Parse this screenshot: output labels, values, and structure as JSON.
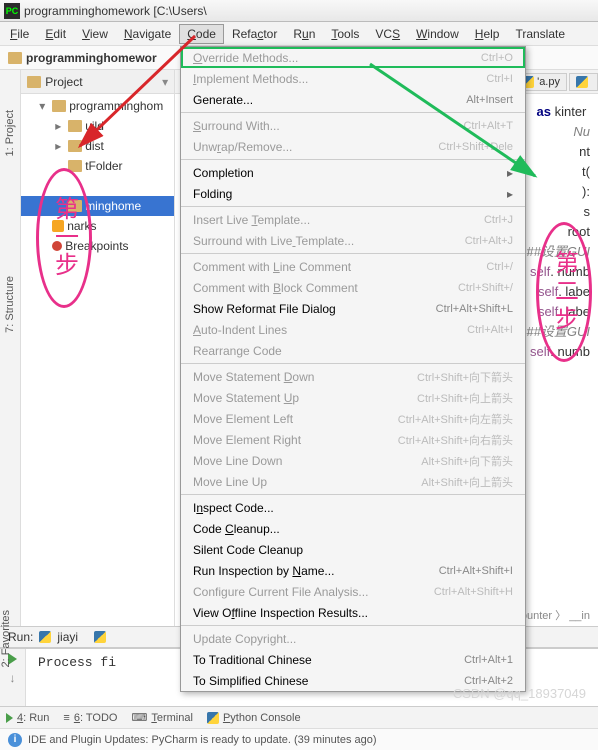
{
  "title": "programminghomework [C:\\Users\\",
  "menubar": [
    "File",
    "Edit",
    "View",
    "Navigate",
    "Code",
    "Refactor",
    "Run",
    "Tools",
    "VCS",
    "Window",
    "Help",
    "Translate"
  ],
  "menubar_underline": [
    0,
    0,
    0,
    0,
    0,
    4,
    1,
    0,
    2,
    0,
    0,
    -1
  ],
  "active_menu_index": 4,
  "breadcrumb": "programminghomewor",
  "project_header": "Project",
  "tree": [
    {
      "label": "programminghom",
      "icon": "folder",
      "ind": 1,
      "exp": "▾"
    },
    {
      "label": "uild",
      "icon": "folder",
      "ind": 2,
      "exp": "▸"
    },
    {
      "label": "dist",
      "icon": "folder",
      "ind": 2,
      "exp": "▸"
    },
    {
      "label": "tFolder",
      "icon": "folder",
      "ind": 2,
      "exp": ""
    },
    {
      "label": "",
      "icon": "",
      "ind": 2,
      "exp": ""
    },
    {
      "label": "minghome",
      "icon": "folder",
      "ind": 2,
      "exp": "",
      "sel": true
    },
    {
      "label": "narks",
      "icon": "book",
      "ind": 1,
      "exp": ""
    },
    {
      "label": "Breakpoints",
      "icon": "dot",
      "ind": 1,
      "exp": ""
    }
  ],
  "left_gutter": [
    "1: Project",
    "7: Structure",
    "2: Favorites"
  ],
  "tabs": [
    {
      "label": "'a.py"
    },
    {
      "label": ""
    }
  ],
  "code_lines": [
    "",
    "<span class='kw'>as</span> kinter ",
    "",
    "<span class='cm'>Nu</span>",
    "nt",
    "t(",
    "):",
    "",
    "",
    "",
    "s",
    "root",
    "",
    "<span class='cm'>##设置GUI</span>",
    "<span class='slf'>self</span>. numb",
    "<span class='slf'>self</span>. labe",
    "<span class='slf'>self</span>. labe",
    "",
    "<span class='cm'>##设置GUI</span>",
    "<span class='slf'>self</span>. numb"
  ],
  "breadcrumb_code": "ounter 〉 __in",
  "dropdown": [
    {
      "label": "Override Methods...",
      "sc": "Ctrl+O",
      "hl": true,
      "dis": true,
      "u": 0
    },
    {
      "label": "Implement Methods...",
      "sc": "Ctrl+I",
      "dis": true,
      "u": 0
    },
    {
      "label": "Generate...",
      "sc": "Alt+Insert",
      "u": -1
    },
    {
      "sep": true
    },
    {
      "label": "Surround With...",
      "sc": "Ctrl+Alt+T",
      "dis": true,
      "u": 0
    },
    {
      "label": "Unwrap/Remove...",
      "sc": "Ctrl+Shift+Dele",
      "dis": true,
      "u": 3
    },
    {
      "sep": true
    },
    {
      "label": "Completion",
      "sub": true,
      "u": -1
    },
    {
      "label": "Folding",
      "sub": true,
      "u": -1
    },
    {
      "sep": true
    },
    {
      "label": "Insert Live Template...",
      "sc": "Ctrl+J",
      "dis": true,
      "u": 12
    },
    {
      "label": "Surround with Live Template...",
      "sc": "Ctrl+Alt+J",
      "dis": true,
      "u": 18
    },
    {
      "sep": true
    },
    {
      "label": "Comment with Line Comment",
      "sc": "Ctrl+/",
      "dis": true,
      "u": 13
    },
    {
      "label": "Comment with Block Comment",
      "sc": "Ctrl+Shift+/",
      "dis": true,
      "u": 13
    },
    {
      "label": "Show Reformat File Dialog",
      "sc": "Ctrl+Alt+Shift+L",
      "u": -1
    },
    {
      "label": "Auto-Indent Lines",
      "sc": "Ctrl+Alt+I",
      "dis": true,
      "u": 0
    },
    {
      "label": "Rearrange Code",
      "dis": true,
      "u": -1
    },
    {
      "sep": true
    },
    {
      "label": "Move Statement Down",
      "sc": "Ctrl+Shift+向下箭头",
      "dis": true,
      "u": 15
    },
    {
      "label": "Move Statement Up",
      "sc": "Ctrl+Shift+向上箭头",
      "dis": true,
      "u": 15
    },
    {
      "label": "Move Element Left",
      "sc": "Ctrl+Alt+Shift+向左箭头",
      "dis": true,
      "u": -1
    },
    {
      "label": "Move Element Right",
      "sc": "Ctrl+Alt+Shift+向右箭头",
      "dis": true,
      "u": -1
    },
    {
      "label": "Move Line Down",
      "sc": "Alt+Shift+向下箭头",
      "dis": true,
      "u": -1
    },
    {
      "label": "Move Line Up",
      "sc": "Alt+Shift+向上箭头",
      "dis": true,
      "u": -1
    },
    {
      "sep": true
    },
    {
      "label": "Inspect Code...",
      "u": 1
    },
    {
      "label": "Code Cleanup...",
      "u": 5
    },
    {
      "label": "Silent Code Cleanup",
      "u": -1
    },
    {
      "label": "Run Inspection by Name...",
      "sc": "Ctrl+Alt+Shift+I",
      "u": 18
    },
    {
      "label": "Configure Current File Analysis...",
      "sc": "Ctrl+Alt+Shift+H",
      "dis": true,
      "u": -1
    },
    {
      "label": "View Offline Inspection Results...",
      "u": 6
    },
    {
      "sep": true
    },
    {
      "label": "Update Copyright...",
      "dis": true,
      "u": -1
    },
    {
      "label": "To Traditional Chinese",
      "sc": "Ctrl+Alt+1",
      "u": -1
    },
    {
      "label": "To Simplified Chinese",
      "sc": "Ctrl+Alt+2",
      "u": -1
    }
  ],
  "run_label": "Run:",
  "run_tabs": [
    "jiayi",
    ""
  ],
  "run_output": "Process fi",
  "bottom_tabs": [
    {
      "label": "4: Run",
      "icon": "play"
    },
    {
      "label": "6: TODO",
      "icon": "list"
    },
    {
      "label": "Terminal",
      "icon": "term"
    },
    {
      "label": "Python Console",
      "icon": "py"
    }
  ],
  "statusbar": "IDE and Plugin Updates: PyCharm is ready to update. (39 minutes ago)",
  "annotations": {
    "red": "第一步",
    "green": "第二步"
  },
  "watermark": "CSDN @qq_18937049"
}
